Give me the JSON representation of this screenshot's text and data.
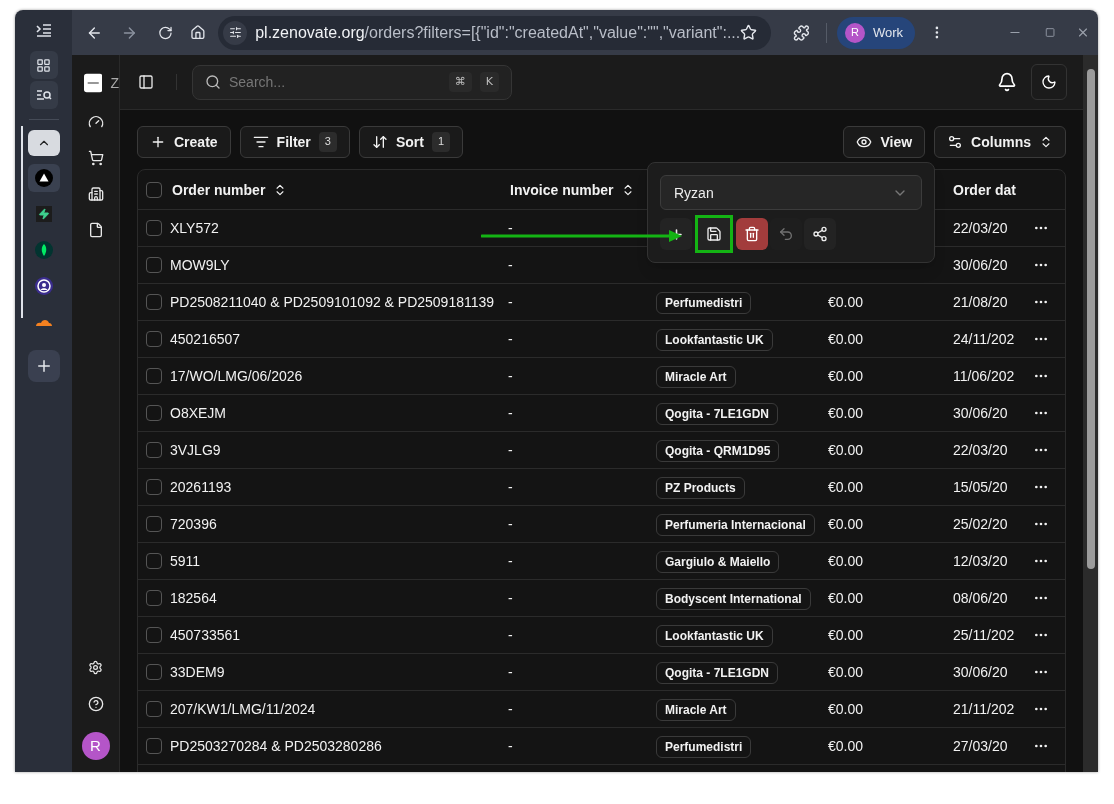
{
  "browser": {
    "url_host": "pl.zenovate.org",
    "url_path": "/orders?filters=[{\"id\":\"createdAt\",\"value\":\"\",\"variant\":...",
    "profile": {
      "initial": "R",
      "label": "Work"
    }
  },
  "tab_strip": {
    "apps": [
      {
        "kind": "triangle",
        "selected": true
      },
      {
        "kind": "bolt",
        "selected": false
      },
      {
        "kind": "leaf",
        "selected": false
      },
      {
        "kind": "ring",
        "selected": false
      },
      {
        "kind": "cloud",
        "selected": false
      }
    ]
  },
  "app": {
    "brand": "Z",
    "search": {
      "placeholder": "Search...",
      "keys": [
        "⌘",
        "K"
      ]
    },
    "user_initial": "R"
  },
  "toolbar": {
    "left": [
      {
        "kind": "create",
        "label": "Create"
      },
      {
        "kind": "filter",
        "label": "Filter",
        "count": "3"
      },
      {
        "kind": "sort",
        "label": "Sort",
        "count": "1"
      }
    ],
    "right": [
      {
        "kind": "view",
        "label": "View"
      },
      {
        "kind": "columns",
        "label": "Columns"
      }
    ]
  },
  "table": {
    "all_checked": false,
    "columns": [
      {
        "label": "Order number",
        "sortable": true
      },
      {
        "label": "Invoice number",
        "sortable": true
      },
      {
        "label": "Order dat"
      }
    ],
    "rows": [
      {
        "order": "XLY572",
        "invoice": "-",
        "date": "22/03/20",
        "checked": false
      },
      {
        "order": "MOW9LY",
        "invoice": "-",
        "date": "30/06/20",
        "checked": false
      },
      {
        "order": "PD2508211040 & PD2509101092 & PD2509181139",
        "invoice": "-",
        "supplier": "Perfumedistri",
        "amount": "€0.00",
        "date": "21/08/20",
        "checked": false
      },
      {
        "order": "450216507",
        "invoice": "-",
        "supplier": "Lookfantastic UK",
        "amount": "€0.00",
        "date": "24/11/202",
        "checked": false
      },
      {
        "order": "17/WO/LMG/06/2026",
        "invoice": "-",
        "supplier": "Miracle Art",
        "amount": "€0.00",
        "date": "11/06/202",
        "checked": false
      },
      {
        "order": "O8XEJM",
        "invoice": "-",
        "supplier": "Qogita - 7LE1GDN",
        "amount": "€0.00",
        "date": "30/06/20",
        "checked": false
      },
      {
        "order": "3VJLG9",
        "invoice": "-",
        "supplier": "Qogita - QRM1D95",
        "amount": "€0.00",
        "date": "22/03/20",
        "checked": false
      },
      {
        "order": "20261193",
        "invoice": "-",
        "supplier": "PZ Products",
        "amount": "€0.00",
        "date": "15/05/20",
        "checked": false
      },
      {
        "order": "720396",
        "invoice": "-",
        "supplier": "Perfumeria Internacional",
        "amount": "€0.00",
        "date": "25/02/20",
        "checked": false
      },
      {
        "order": "5911",
        "invoice": "-",
        "supplier": "Gargiulo & Maiello",
        "amount": "€0.00",
        "date": "12/03/20",
        "checked": false
      },
      {
        "order": "182564",
        "invoice": "-",
        "supplier": "Bodyscent International",
        "amount": "€0.00",
        "date": "08/06/20",
        "checked": false
      },
      {
        "order": "450733561",
        "invoice": "-",
        "supplier": "Lookfantastic UK",
        "amount": "€0.00",
        "date": "25/11/202",
        "checked": false
      },
      {
        "order": "33DEM9",
        "invoice": "-",
        "supplier": "Qogita - 7LE1GDN",
        "amount": "€0.00",
        "date": "30/06/20",
        "checked": false
      },
      {
        "order": "207/KW1/LMG/11/2024",
        "invoice": "-",
        "supplier": "Miracle Art",
        "amount": "€0.00",
        "date": "21/11/202",
        "checked": false
      },
      {
        "order": "PD2503270284 & PD2503280286",
        "invoice": "-",
        "supplier": "Perfumedistri",
        "amount": "€0.00",
        "date": "27/03/20",
        "checked": false
      }
    ]
  },
  "view_popover": {
    "view_name": "Ryzan",
    "actions": [
      {
        "kind": "add",
        "highlighted": false,
        "disabled": false
      },
      {
        "kind": "save",
        "highlighted": true,
        "disabled": false
      },
      {
        "kind": "delete",
        "highlighted": false,
        "disabled": false
      },
      {
        "kind": "undo",
        "highlighted": false,
        "disabled": true
      },
      {
        "kind": "share",
        "highlighted": false,
        "disabled": false
      }
    ]
  }
}
